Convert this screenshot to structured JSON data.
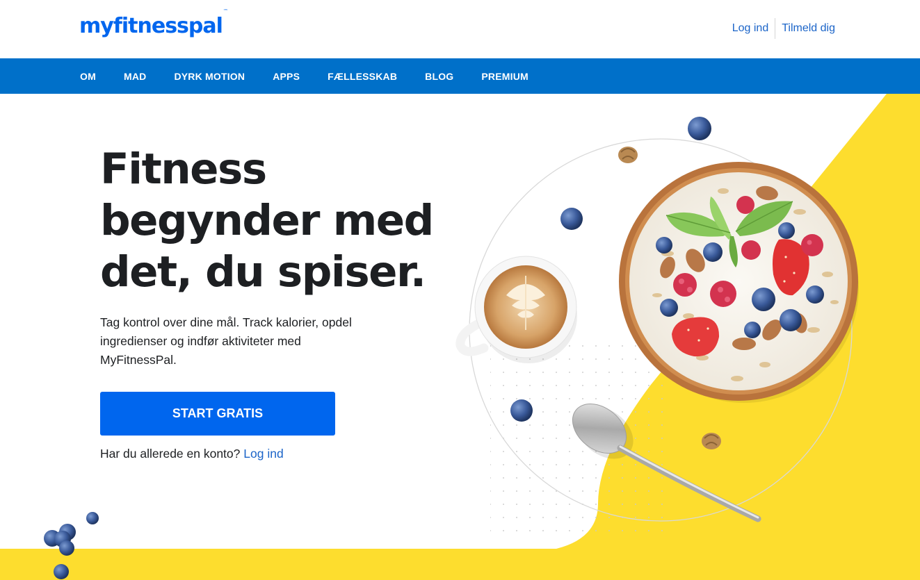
{
  "header": {
    "logo_text": "myfitnesspal",
    "logo_tm": "™",
    "login_link": "Log ind",
    "signup_link": "Tilmeld dig"
  },
  "nav": {
    "items": [
      {
        "label": "OM"
      },
      {
        "label": "MAD"
      },
      {
        "label": "DYRK MOTION"
      },
      {
        "label": "APPS"
      },
      {
        "label": "FÆLLESSKAB"
      },
      {
        "label": "BLOG"
      },
      {
        "label": "PREMIUM"
      }
    ]
  },
  "hero": {
    "headline_line1": "Fitness",
    "headline_line2": "begynder med",
    "headline_line3": "det, du spiser.",
    "subtext": "Tag kontrol over dine mål. Track kalorier, opdel ingredienser og indfør aktiviteter med MyFitnessPal.",
    "cta_label": "START GRATIS",
    "login_prompt": "Har du allerede en konto?",
    "login_link": "Log ind"
  },
  "colors": {
    "brand_blue": "#0066ee",
    "nav_blue": "#0070c9",
    "accent_yellow": "#fddd2e",
    "link_blue": "#1b64c8",
    "text_dark": "#1d1f22"
  },
  "icons": [
    "blueberry-icon",
    "walnut-icon",
    "coffee-cup-icon",
    "cereal-bowl-icon",
    "spoon-icon"
  ]
}
